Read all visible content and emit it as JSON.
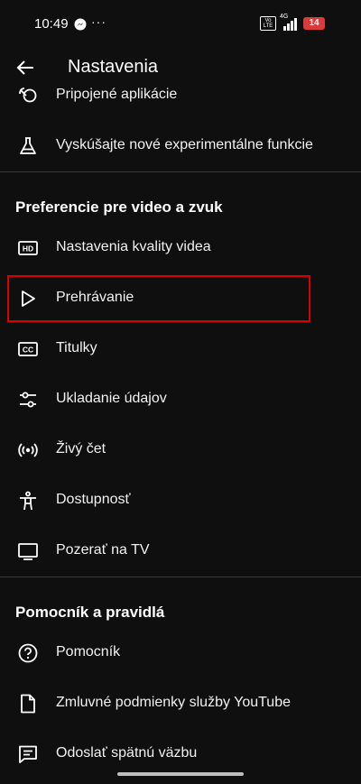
{
  "status_bar": {
    "time": "10:49",
    "more": "···",
    "volte": "Vo LTE",
    "network": "4G",
    "battery": "14"
  },
  "app_bar": {
    "title": "Nastavenia"
  },
  "items_top": [
    {
      "label": "Pripojené aplikácie",
      "icon": "connected-apps-icon"
    },
    {
      "label": "Vyskúšajte nové experimentálne funkcie",
      "icon": "flask-icon"
    }
  ],
  "section_video": {
    "title": "Preferencie pre video a zvuk",
    "items": [
      {
        "label": "Nastavenia kvality videa",
        "icon": "hd-icon"
      },
      {
        "label": "Prehrávanie",
        "icon": "play-icon"
      },
      {
        "label": "Titulky",
        "icon": "cc-icon"
      },
      {
        "label": "Ukladanie údajov",
        "icon": "sliders-icon"
      },
      {
        "label": "Živý čet",
        "icon": "live-icon"
      },
      {
        "label": "Dostupnosť",
        "icon": "accessibility-icon"
      },
      {
        "label": "Pozerať na TV",
        "icon": "tv-icon"
      }
    ]
  },
  "section_help": {
    "title": "Pomocník a pravidlá",
    "items": [
      {
        "label": "Pomocník",
        "icon": "help-icon"
      },
      {
        "label": "Zmluvné podmienky služby YouTube",
        "icon": "document-icon"
      },
      {
        "label": "Odoslať spätnú väzbu",
        "icon": "feedback-icon"
      }
    ]
  },
  "colors": {
    "background": "#0f0f0f",
    "text": "#f1f1f1",
    "highlight": "#d80000",
    "divider": "#3a3a3a",
    "battery": "#d93a3a"
  }
}
